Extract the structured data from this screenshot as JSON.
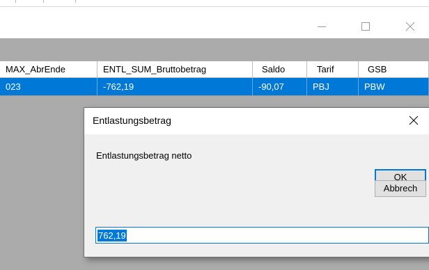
{
  "window": {
    "controls": {
      "minimize": "minimize-icon",
      "maximize": "maximize-icon",
      "close": "close-icon"
    }
  },
  "grid": {
    "columns": [
      "MAX_AbrEnde",
      "ENTL_SUM_Bruttobetrag",
      "Saldo",
      "Tarif",
      "GSB"
    ],
    "rows": [
      [
        "023",
        "-762,19",
        "-90,07",
        "PBJ",
        "PBW"
      ]
    ],
    "selection_color": "#0078d7"
  },
  "dialog": {
    "title": "Entlastungsbetrag",
    "prompt": "Entlastungsbetrag netto",
    "ok_label": "OK",
    "cancel_label": "Abbrech",
    "input_value": "762,19"
  },
  "colors": {
    "accent": "#0078d7",
    "grid_background": "#ababab",
    "dialog_background": "#f0f0f0"
  }
}
